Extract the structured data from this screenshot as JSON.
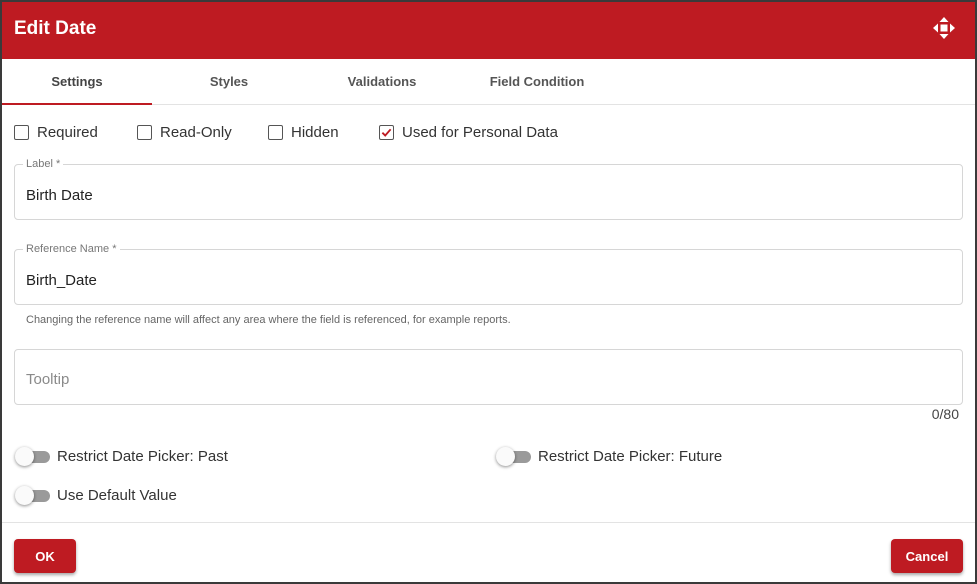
{
  "dialog": {
    "title": "Edit Date",
    "move_icon": "move-arrows-icon"
  },
  "tabs": [
    {
      "label": "Settings",
      "active": true
    },
    {
      "label": "Styles",
      "active": false
    },
    {
      "label": "Validations",
      "active": false
    },
    {
      "label": "Field Condition",
      "active": false
    }
  ],
  "checkboxes": [
    {
      "label": "Required",
      "checked": false
    },
    {
      "label": "Read-Only",
      "checked": false
    },
    {
      "label": "Hidden",
      "checked": false
    },
    {
      "label": "Used for Personal Data",
      "checked": true
    }
  ],
  "fields": {
    "label": {
      "legend": "Label *",
      "value": "Birth Date"
    },
    "reference": {
      "legend": "Reference Name *",
      "value": "Birth_Date",
      "hint": "Changing the reference name will affect any area where the field is referenced, for example reports."
    },
    "tooltip": {
      "placeholder": "Tooltip",
      "value": "",
      "counter": "0/80"
    }
  },
  "toggles": [
    {
      "label": "Restrict Date Picker: Past",
      "on": false
    },
    {
      "label": "Restrict Date Picker: Future",
      "on": false
    },
    {
      "label": "Use Default Value",
      "on": false
    }
  ],
  "footer": {
    "ok_label": "OK",
    "cancel_label": "Cancel"
  },
  "colors": {
    "brand": "#be1b22",
    "toggle_off": "#9a9a9a"
  }
}
